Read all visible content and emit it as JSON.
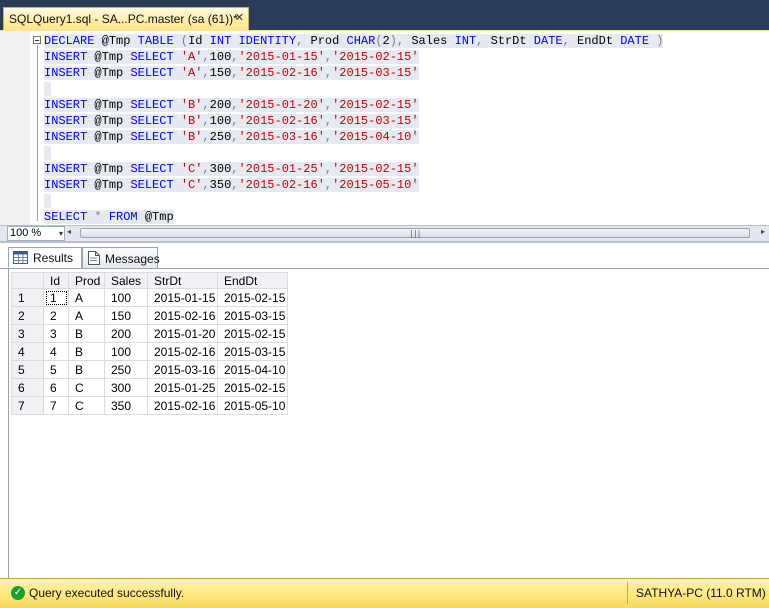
{
  "document_tab": {
    "title": "SQLQuery1.sql - SA...PC.master (sa (61))*",
    "close_glyph": "✕"
  },
  "editor": {
    "lines": [
      [
        {
          "t": "DECLARE",
          "c": "kw"
        },
        {
          "t": " @Tmp ",
          "c": "id"
        },
        {
          "t": "TABLE",
          "c": "kw"
        },
        {
          "t": " (",
          "c": "op"
        },
        {
          "t": "Id ",
          "c": "id"
        },
        {
          "t": "INT IDENTITY",
          "c": "kw"
        },
        {
          "t": ",",
          "c": "op"
        },
        {
          "t": " Prod ",
          "c": "id"
        },
        {
          "t": "CHAR",
          "c": "kw"
        },
        {
          "t": "(",
          "c": "op"
        },
        {
          "t": "2",
          "c": "num"
        },
        {
          "t": "),",
          "c": "op"
        },
        {
          "t": " Sales ",
          "c": "id"
        },
        {
          "t": "INT",
          "c": "kw"
        },
        {
          "t": ",",
          "c": "op"
        },
        {
          "t": " StrDt ",
          "c": "id"
        },
        {
          "t": "DATE",
          "c": "kw"
        },
        {
          "t": ",",
          "c": "op"
        },
        {
          "t": " EndDt ",
          "c": "id"
        },
        {
          "t": "DATE",
          "c": "kw"
        },
        {
          "t": " )",
          "c": "op"
        }
      ],
      [
        {
          "t": "INSERT",
          "c": "kw"
        },
        {
          "t": " @Tmp ",
          "c": "id"
        },
        {
          "t": "SELECT",
          "c": "kw"
        },
        {
          "t": " ",
          "c": "id"
        },
        {
          "t": "'A'",
          "c": "str"
        },
        {
          "t": ",",
          "c": "op"
        },
        {
          "t": "100",
          "c": "num"
        },
        {
          "t": ",",
          "c": "op"
        },
        {
          "t": "'2015-01-15'",
          "c": "str"
        },
        {
          "t": ",",
          "c": "op"
        },
        {
          "t": "'2015-02-15'",
          "c": "str"
        }
      ],
      [
        {
          "t": "INSERT",
          "c": "kw"
        },
        {
          "t": " @Tmp ",
          "c": "id"
        },
        {
          "t": "SELECT",
          "c": "kw"
        },
        {
          "t": " ",
          "c": "id"
        },
        {
          "t": "'A'",
          "c": "str"
        },
        {
          "t": ",",
          "c": "op"
        },
        {
          "t": "150",
          "c": "num"
        },
        {
          "t": ",",
          "c": "op"
        },
        {
          "t": "'2015-02-16'",
          "c": "str"
        },
        {
          "t": ",",
          "c": "op"
        },
        {
          "t": "'2015-03-15'",
          "c": "str"
        }
      ],
      [],
      [
        {
          "t": "INSERT",
          "c": "kw"
        },
        {
          "t": " @Tmp ",
          "c": "id"
        },
        {
          "t": "SELECT",
          "c": "kw"
        },
        {
          "t": " ",
          "c": "id"
        },
        {
          "t": "'B'",
          "c": "str"
        },
        {
          "t": ",",
          "c": "op"
        },
        {
          "t": "200",
          "c": "num"
        },
        {
          "t": ",",
          "c": "op"
        },
        {
          "t": "'2015-01-20'",
          "c": "str"
        },
        {
          "t": ",",
          "c": "op"
        },
        {
          "t": "'2015-02-15'",
          "c": "str"
        }
      ],
      [
        {
          "t": "INSERT",
          "c": "kw"
        },
        {
          "t": " @Tmp ",
          "c": "id"
        },
        {
          "t": "SELECT",
          "c": "kw"
        },
        {
          "t": " ",
          "c": "id"
        },
        {
          "t": "'B'",
          "c": "str"
        },
        {
          "t": ",",
          "c": "op"
        },
        {
          "t": "100",
          "c": "num"
        },
        {
          "t": ",",
          "c": "op"
        },
        {
          "t": "'2015-02-16'",
          "c": "str"
        },
        {
          "t": ",",
          "c": "op"
        },
        {
          "t": "'2015-03-15'",
          "c": "str"
        }
      ],
      [
        {
          "t": "INSERT",
          "c": "kw"
        },
        {
          "t": " @Tmp ",
          "c": "id"
        },
        {
          "t": "SELECT",
          "c": "kw"
        },
        {
          "t": " ",
          "c": "id"
        },
        {
          "t": "'B'",
          "c": "str"
        },
        {
          "t": ",",
          "c": "op"
        },
        {
          "t": "250",
          "c": "num"
        },
        {
          "t": ",",
          "c": "op"
        },
        {
          "t": "'2015-03-16'",
          "c": "str"
        },
        {
          "t": ",",
          "c": "op"
        },
        {
          "t": "'2015-04-10'",
          "c": "str"
        }
      ],
      [],
      [
        {
          "t": "INSERT",
          "c": "kw"
        },
        {
          "t": " @Tmp ",
          "c": "id"
        },
        {
          "t": "SELECT",
          "c": "kw"
        },
        {
          "t": " ",
          "c": "id"
        },
        {
          "t": "'C'",
          "c": "str"
        },
        {
          "t": ",",
          "c": "op"
        },
        {
          "t": "300",
          "c": "num"
        },
        {
          "t": ",",
          "c": "op"
        },
        {
          "t": "'2015-01-25'",
          "c": "str"
        },
        {
          "t": ",",
          "c": "op"
        },
        {
          "t": "'2015-02-15'",
          "c": "str"
        }
      ],
      [
        {
          "t": "INSERT",
          "c": "kw"
        },
        {
          "t": " @Tmp ",
          "c": "id"
        },
        {
          "t": "SELECT",
          "c": "kw"
        },
        {
          "t": " ",
          "c": "id"
        },
        {
          "t": "'C'",
          "c": "str"
        },
        {
          "t": ",",
          "c": "op"
        },
        {
          "t": "350",
          "c": "num"
        },
        {
          "t": ",",
          "c": "op"
        },
        {
          "t": "'2015-02-16'",
          "c": "str"
        },
        {
          "t": ",",
          "c": "op"
        },
        {
          "t": "'2015-05-10'",
          "c": "str"
        }
      ],
      [],
      [
        {
          "t": "SELECT",
          "c": "kw"
        },
        {
          "t": " * ",
          "c": "op"
        },
        {
          "t": "FROM",
          "c": "kw"
        },
        {
          "t": " @Tmp",
          "c": "id"
        }
      ]
    ]
  },
  "zoom": {
    "value": "100 %",
    "arrow_glyph": "▾"
  },
  "scrollbar": {
    "left_glyph": "◂",
    "right_glyph": "▸",
    "grip_glyph": "|||"
  },
  "results_tabs": {
    "results_label": "Results",
    "messages_label": "Messages"
  },
  "grid": {
    "columns": [
      "Id",
      "Prod",
      "Sales",
      "StrDt",
      "EndDt"
    ],
    "rows": [
      [
        "1",
        "1",
        "A",
        "100",
        "2015-01-15",
        "2015-02-15"
      ],
      [
        "2",
        "2",
        "A",
        "150",
        "2015-02-16",
        "2015-03-15"
      ],
      [
        "3",
        "3",
        "B",
        "200",
        "2015-01-20",
        "2015-02-15"
      ],
      [
        "4",
        "4",
        "B",
        "100",
        "2015-02-16",
        "2015-03-15"
      ],
      [
        "5",
        "5",
        "B",
        "250",
        "2015-03-16",
        "2015-04-10"
      ],
      [
        "6",
        "6",
        "C",
        "300",
        "2015-01-25",
        "2015-02-15"
      ],
      [
        "7",
        "7",
        "C",
        "350",
        "2015-02-16",
        "2015-05-10"
      ]
    ]
  },
  "status": {
    "message": "Query executed successfully.",
    "server": "SATHYA-PC (11.0 RTM)",
    "icon_glyph": "✓",
    "color": "#ffe87a"
  },
  "colors": {
    "keyword": "#0000ff",
    "string": "#cc0000",
    "tab_active": "#ffe38a",
    "frame": "#2b3c59"
  }
}
